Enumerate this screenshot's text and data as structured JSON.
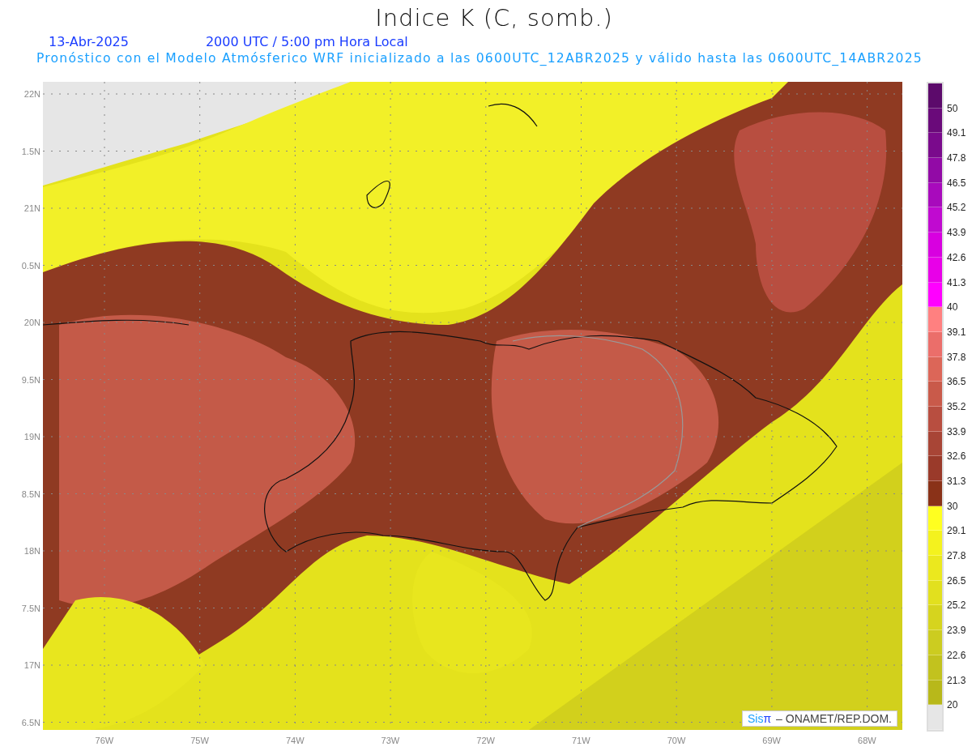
{
  "title": "Indice K (C, somb.)",
  "date": "13-Abr-2025",
  "time": "2000 UTC / 5:00 pm Hora Local",
  "subtitle": "Pronóstico con el Modelo Atmósferico WRF inicializado a las 0600UTC_12ABR2025 y válido hasta las  0600UTC_14ABR2025",
  "lat_labels": [
    "22N",
    "1.5N",
    "21N",
    "0.5N",
    "20N",
    "9.5N",
    "19N",
    "8.5N",
    "18N",
    "7.5N",
    "17N",
    "6.5N"
  ],
  "lon_labels": [
    "76W",
    "75W",
    "74W",
    "73W",
    "72W",
    "71W",
    "70W",
    "69W",
    "68W"
  ],
  "credit": {
    "logo": "Sisπ",
    "text": "– ONAMET/REP.DOM."
  },
  "colorbar": {
    "levels": [
      {
        "color": "#5c0a6b",
        "label": "50"
      },
      {
        "color": "#6a0a7a",
        "label": "49.1"
      },
      {
        "color": "#7a0a8c",
        "label": "47.8"
      },
      {
        "color": "#920aa6",
        "label": "46.5"
      },
      {
        "color": "#a80abc",
        "label": "45.2"
      },
      {
        "color": "#c00ad0",
        "label": "43.9"
      },
      {
        "color": "#d800e0",
        "label": "42.6"
      },
      {
        "color": "#e800e8",
        "label": "41.3"
      },
      {
        "color": "#ff00ff",
        "label": "40"
      },
      {
        "color": "#ff8080",
        "label": "39.1"
      },
      {
        "color": "#eb6e6a",
        "label": "37.8"
      },
      {
        "color": "#dc6658",
        "label": "36.5"
      },
      {
        "color": "#c95a4a",
        "label": "35.2"
      },
      {
        "color": "#b84e40",
        "label": "33.9"
      },
      {
        "color": "#a84536",
        "label": "32.6"
      },
      {
        "color": "#9a3a2a",
        "label": "31.3"
      },
      {
        "color": "#8a3218",
        "label": "30"
      },
      {
        "color": "#ffff20",
        "label": "29.1"
      },
      {
        "color": "#f4f21e",
        "label": "27.8"
      },
      {
        "color": "#ebe81e",
        "label": "26.5"
      },
      {
        "color": "#e2e01e",
        "label": "25.2"
      },
      {
        "color": "#d6d41e",
        "label": "23.9"
      },
      {
        "color": "#cccc20",
        "label": "22.6"
      },
      {
        "color": "#c2c21e",
        "label": "21.3"
      },
      {
        "color": "#b8b81a",
        "label": "20"
      },
      {
        "color": "#e6e6e6"
      }
    ]
  }
}
